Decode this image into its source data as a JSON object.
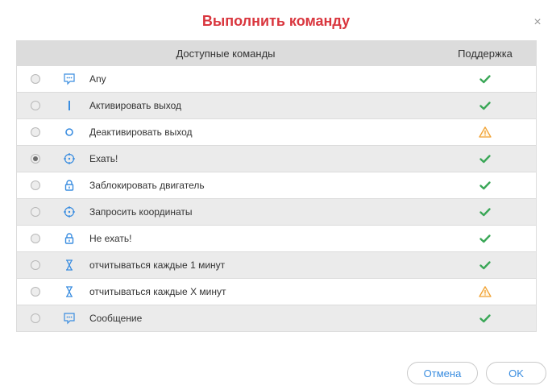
{
  "dialog": {
    "title": "Выполнить команду",
    "close_glyph": "×"
  },
  "table": {
    "headers": {
      "commands": "Доступные команды",
      "support": "Поддержка"
    },
    "rows": [
      {
        "label": "Any",
        "icon": "message-icon",
        "support": "check-icon",
        "selected": false
      },
      {
        "label": "Активировать выход",
        "icon": "line-icon",
        "support": "check-icon",
        "selected": false
      },
      {
        "label": "Деактивировать выход",
        "icon": "circle-icon",
        "support": "warning-icon",
        "selected": false
      },
      {
        "label": "Ехать!",
        "icon": "crosshair-icon",
        "support": "check-icon",
        "selected": true
      },
      {
        "label": "Заблокировать двигатель",
        "icon": "lock-icon",
        "support": "check-icon",
        "selected": false
      },
      {
        "label": "Запросить координаты",
        "icon": "crosshair-icon",
        "support": "check-icon",
        "selected": false
      },
      {
        "label": "Не ехать!",
        "icon": "lock-icon",
        "support": "check-icon",
        "selected": false
      },
      {
        "label": "отчитываться каждые 1 минут",
        "icon": "hourglass-icon",
        "support": "check-icon",
        "selected": false
      },
      {
        "label": "отчитываться каждые X минут",
        "icon": "hourglass-icon",
        "support": "warning-icon",
        "selected": false
      },
      {
        "label": "Сообщение",
        "icon": "message-icon",
        "support": "check-icon",
        "selected": false
      }
    ]
  },
  "buttons": {
    "cancel": "Отмена",
    "ok": "OK"
  },
  "colors": {
    "title": "#d9363e",
    "accent": "#3a8de0",
    "check": "#3aa757",
    "warning": "#f0a030"
  }
}
